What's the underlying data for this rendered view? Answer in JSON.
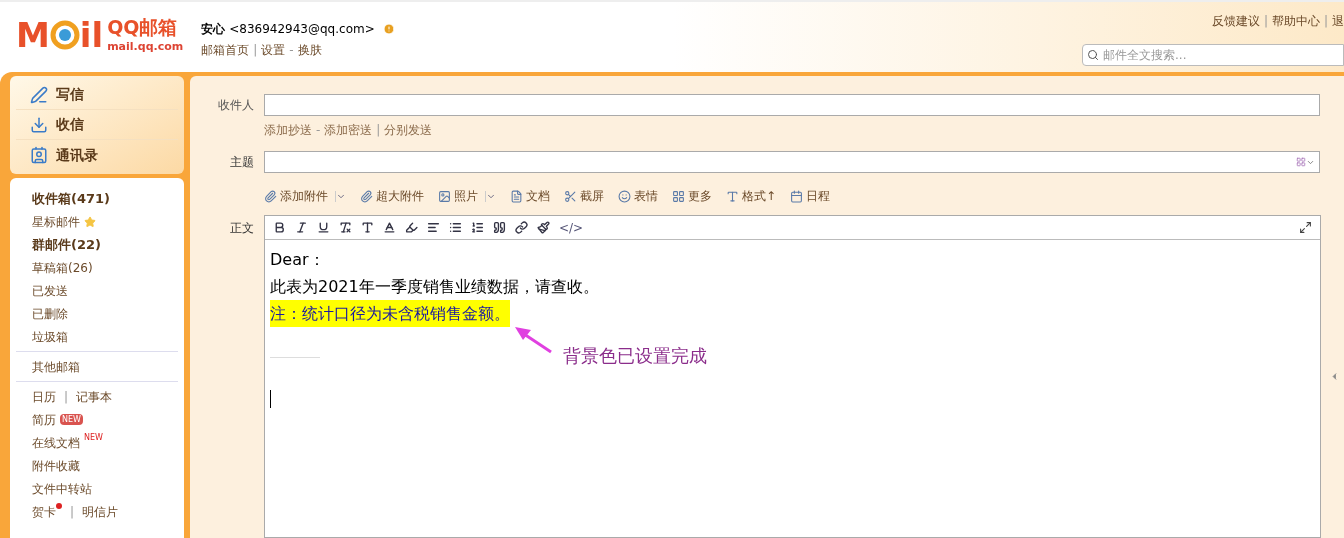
{
  "header": {
    "logo": {
      "left": "M",
      "right": "il",
      "name": "QQ邮箱",
      "domain": "mail.qq.com"
    },
    "user": {
      "name": "安心",
      "email": "<836942943@qq.com>"
    },
    "user_links": [
      {
        "label": "邮箱首页",
        "sep": "|"
      },
      {
        "label": "设置",
        "sep": "-"
      },
      {
        "label": "换肤"
      }
    ],
    "top_links": [
      {
        "label": "反馈建议",
        "sep": "|"
      },
      {
        "label": "帮助中心",
        "sep": "|"
      },
      {
        "label": "退"
      }
    ],
    "search": {
      "placeholder": "邮件全文搜索..."
    }
  },
  "sidebar": {
    "actions": [
      {
        "label": "写信",
        "kind": "compose"
      },
      {
        "label": "收信",
        "kind": "inbox"
      },
      {
        "label": "通讯录",
        "kind": "contacts"
      }
    ],
    "groups": [
      [
        [
          {
            "label": "收件箱(471)",
            "bold": true
          }
        ],
        [
          {
            "label": "星标邮件",
            "kind": "starred",
            "bold": false
          }
        ],
        [
          {
            "label": "群邮件(22)",
            "bold": true
          }
        ],
        [
          {
            "label": "草稿箱(26)",
            "bold": false
          }
        ],
        [
          {
            "label": "已发送",
            "bold": false
          }
        ],
        [
          {
            "label": "已删除",
            "bold": false
          }
        ],
        [
          {
            "label": "垃圾箱",
            "bold": false
          }
        ]
      ],
      [
        [
          {
            "label": "其他邮箱",
            "bold": false
          }
        ]
      ],
      [
        [
          {
            "label": "日历",
            "sep": "|",
            "bold": false
          },
          {
            "label": "记事本",
            "bold": false
          }
        ],
        [
          {
            "label": "简历",
            "badge": "NEW",
            "kind": "boxed_badge",
            "bold": false
          }
        ],
        [
          {
            "label": "在线文档",
            "badge": "NEW",
            "kind": "raised_badge",
            "bold": false
          }
        ],
        [
          {
            "label": "附件收藏",
            "bold": false
          }
        ],
        [
          {
            "label": "文件中转站",
            "bold": false
          }
        ],
        [
          {
            "label": "贺卡",
            "kind": "unread_dot",
            "sep": "|",
            "bold": false
          },
          {
            "label": "明信片",
            "bold": false
          }
        ]
      ]
    ]
  },
  "compose": {
    "to": {
      "label": "收件人"
    },
    "recipient_links": [
      {
        "label": "添加抄送",
        "sep": "-"
      },
      {
        "label": "添加密送",
        "sep": "|"
      },
      {
        "label": "分别发送"
      }
    ],
    "subject": {
      "label": "主题"
    },
    "toolbar": [
      {
        "label": "添加附件",
        "kind": "attach",
        "dropdown": true
      },
      {
        "label": "超大附件",
        "kind": "attach",
        "dropdown": false
      },
      {
        "label": "照片",
        "kind": "photo",
        "dropdown": true
      },
      {
        "label": "文档",
        "kind": "document",
        "dropdown": false
      },
      {
        "label": "截屏",
        "kind": "screenshot",
        "dropdown": false
      },
      {
        "label": "表情",
        "kind": "emoji",
        "dropdown": false
      },
      {
        "label": "更多",
        "kind": "more",
        "dropdown": false
      },
      {
        "label": "格式↑",
        "kind": "format",
        "dropdown": false
      },
      {
        "label": "日程",
        "kind": "schedule",
        "dropdown": false
      }
    ],
    "body_label": "正文",
    "format_tools": [
      {
        "kind": "bold"
      },
      {
        "kind": "italic"
      },
      {
        "kind": "underline"
      },
      {
        "kind": "clear"
      },
      {
        "kind": "size"
      },
      {
        "kind": "color"
      },
      {
        "kind": "highlight"
      },
      {
        "kind": "align"
      },
      {
        "kind": "list"
      },
      {
        "kind": "indent"
      },
      {
        "kind": "quote"
      },
      {
        "kind": "link"
      },
      {
        "kind": "brush"
      },
      {
        "kind": "code",
        "text": "</>"
      }
    ],
    "body": [
      {
        "text": "Dear：",
        "highlight": false
      },
      {
        "text": "此表为2021年一季度销售业绩数据，请查收。",
        "highlight": false
      },
      {
        "text": "注：统计口径为未含税销售金额。",
        "highlight": true
      }
    ],
    "annotation": "背景色已设置完成"
  }
}
